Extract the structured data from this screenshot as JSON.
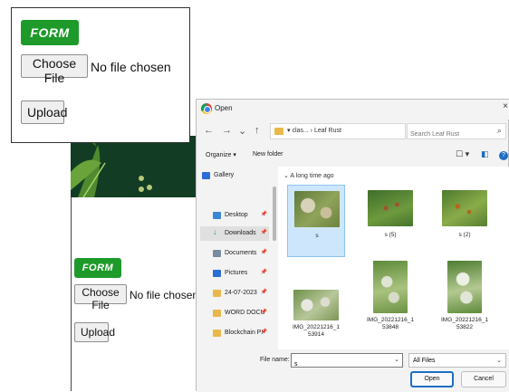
{
  "page": {
    "form_label": "FORM",
    "choose_file_label": "Choose File",
    "no_file_text": "No file chosen",
    "upload_label": "Upload"
  },
  "zoom_card": {
    "form_label": "FORM",
    "choose_file_label": "Choose File",
    "no_file_text": "No file chosen",
    "upload_label": "Upload"
  },
  "dialog": {
    "title": "Open",
    "close": "×",
    "nav": {
      "back": "←",
      "forward": "→",
      "recent": "⌄",
      "up": "↑"
    },
    "breadcrumb": "▾ clas... › Leaf Rust",
    "breadcrumb_chevron": "⌄",
    "refresh": "↻",
    "search_placeholder": "Search Leaf Rust",
    "toolbar": {
      "organize": "Organize ▾",
      "new_folder": "New folder",
      "view": "☐ ▾",
      "preview": "◧",
      "help": "?"
    },
    "sidebar": [
      {
        "label": "Gallery",
        "pinned": false,
        "color": "#2b6cd6"
      },
      {
        "label": "Desktop",
        "pinned": true,
        "color": "#3a86d8"
      },
      {
        "label": "Downloads",
        "pinned": true,
        "color": "#2f9b55",
        "selected": true
      },
      {
        "label": "Documents",
        "pinned": true,
        "color": "#7a8aa0"
      },
      {
        "label": "Pictures",
        "pinned": true,
        "color": "#2b6cd6"
      },
      {
        "label": "24-07-2023",
        "pinned": true,
        "color": "#e8b84a"
      },
      {
        "label": "WORD DOCU",
        "pinned": true,
        "color": "#e8b84a"
      },
      {
        "label": "Blockchain PI",
        "pinned": true,
        "color": "#e8b84a"
      }
    ],
    "group_header": "⌄ A long time ago",
    "files": [
      {
        "name": "s",
        "selected": true
      },
      {
        "name": "s (5)"
      },
      {
        "name": "s (2)"
      },
      {
        "name": "IMG_20221216_1\n53914"
      },
      {
        "name": "IMG_20221216_1\n53848"
      },
      {
        "name": "IMG_20221216_1\n53822"
      }
    ],
    "file_name_label": "File name:",
    "file_name_value": "s",
    "file_type": "All Files",
    "open_label": "Open",
    "cancel_label": "Cancel"
  },
  "colors": {
    "form_green": "#1d9a2a",
    "banner_dark_green": "#123d24",
    "open_button_border": "#1d6ec4",
    "selection_blue": "#cde6fb"
  }
}
